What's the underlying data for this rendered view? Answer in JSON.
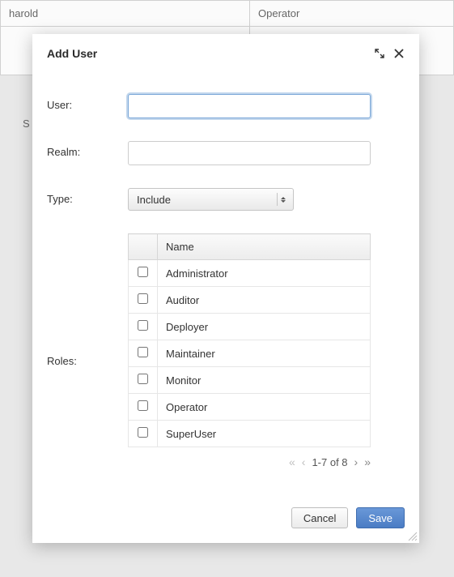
{
  "background": {
    "row_user": "harold",
    "row_role": "Operator",
    "letter": "S"
  },
  "modal": {
    "title": "Add User",
    "labels": {
      "user": "User:",
      "realm": "Realm:",
      "type": "Type:",
      "roles": "Roles:"
    },
    "user_value": "",
    "realm_value": "",
    "type": {
      "selected": "Include"
    },
    "roles_header": {
      "name": "Name"
    },
    "roles": [
      {
        "name": "Administrator"
      },
      {
        "name": "Auditor"
      },
      {
        "name": "Deployer"
      },
      {
        "name": "Maintainer"
      },
      {
        "name": "Monitor"
      },
      {
        "name": "Operator"
      },
      {
        "name": "SuperUser"
      }
    ],
    "pager": {
      "text": "1-7 of 8"
    },
    "buttons": {
      "cancel": "Cancel",
      "save": "Save"
    }
  }
}
